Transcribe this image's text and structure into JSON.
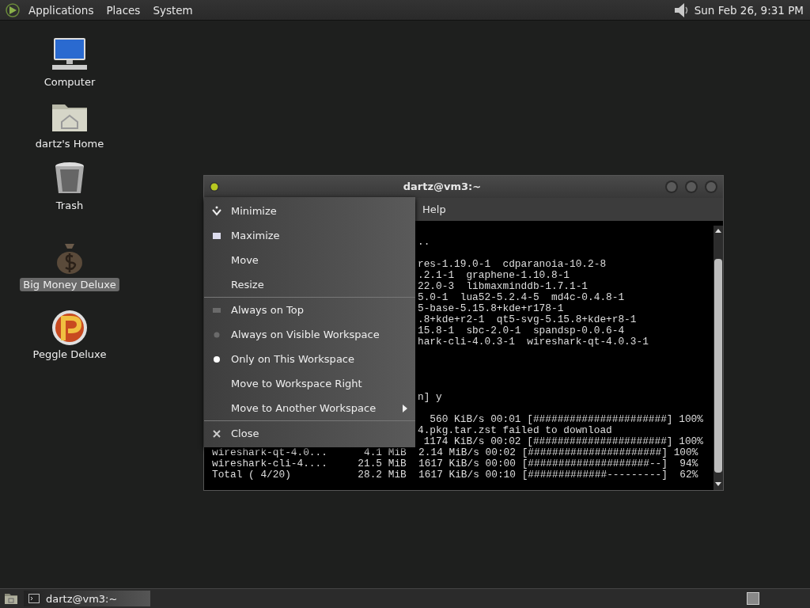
{
  "top_panel": {
    "menus": [
      "Applications",
      "Places",
      "System"
    ],
    "clock": "Sun Feb 26, 9:31 PM"
  },
  "desktop_icons": [
    {
      "kind": "computer",
      "label": "Computer",
      "selected": false
    },
    {
      "kind": "home",
      "label": "dartz's Home",
      "selected": false
    },
    {
      "kind": "trash",
      "label": "Trash",
      "selected": false
    },
    {
      "kind": "money",
      "label": "Big Money Deluxe",
      "selected": true
    },
    {
      "kind": "peggle",
      "label": "Peggle Deluxe",
      "selected": false
    }
  ],
  "window": {
    "title": "dartz@vm3:~",
    "menu_bar": [
      "Help"
    ],
    "terminal_lines": [
      {
        "kind": "blank"
      },
      {
        "kind": "clipped",
        "text": ".."
      },
      {
        "kind": "blank"
      },
      {
        "kind": "clipped",
        "text": "res-1.19.0-1  cdparanoia-10.2-8"
      },
      {
        "kind": "clipped",
        "text": ".2.1-1  graphene-1.10.8-1"
      },
      {
        "kind": "clipped",
        "text": "22.0-3  libmaxminddb-1.7.1-1"
      },
      {
        "kind": "clipped",
        "text": "5.0-1  lua52-5.2.4-5  md4c-0.4.8-1"
      },
      {
        "kind": "clipped",
        "text": "5-base-5.15.8+kde+r178-1"
      },
      {
        "kind": "clipped",
        "text": ".8+kde+r2-1  qt5-svg-5.15.8+kde+r8-1"
      },
      {
        "kind": "clipped",
        "text": "15.8-1  sbc-2.0-1  spandsp-0.0.6-4"
      },
      {
        "kind": "clipped",
        "text": "hark-cli-4.0.3-1  wireshark-qt-4.0.3-1"
      },
      {
        "kind": "blank"
      },
      {
        "kind": "blank"
      },
      {
        "kind": "blank"
      },
      {
        "kind": "blank"
      },
      {
        "kind": "clipped",
        "text": "n] y"
      },
      {
        "kind": "blank"
      },
      {
        "kind": "clipped",
        "text": "  560 KiB/s 00:01 [######################] 100%"
      },
      {
        "kind": "clipped",
        "text": "4.pkg.tar.zst failed to download"
      },
      {
        "kind": "clipped",
        "text": " 1174 KiB/s 00:02 [######################] 100%"
      },
      {
        "kind": "full",
        "text": "wireshark-qt-4.0...      4.1 MiB  2.14 MiB/s 00:02 [######################] 100%"
      },
      {
        "kind": "full",
        "text": "wireshark-cli-4....     21.5 MiB  1617 KiB/s 00:00 [####################--]  94%"
      },
      {
        "kind": "full",
        "text": "Total ( 4/20)           28.2 MiB  1617 KiB/s 00:10 [#############---------]  62%"
      }
    ]
  },
  "window_menu": {
    "items": [
      {
        "kind": "minimize",
        "label": "Minimize"
      },
      {
        "kind": "maximize",
        "label": "Maximize"
      },
      {
        "kind": "plain",
        "label": "Move"
      },
      {
        "kind": "plain",
        "label": "Resize"
      },
      {
        "kind": "separator"
      },
      {
        "kind": "check",
        "label": "Always on Top",
        "checked": false
      },
      {
        "kind": "radio",
        "label": "Always on Visible Workspace",
        "selected": false
      },
      {
        "kind": "radio",
        "label": "Only on This Workspace",
        "selected": true
      },
      {
        "kind": "plain",
        "label": "Move to Workspace Right"
      },
      {
        "kind": "submenu",
        "label": "Move to Another Workspace"
      },
      {
        "kind": "separator"
      },
      {
        "kind": "close",
        "label": "Close"
      }
    ]
  },
  "taskbar": {
    "tasks": [
      {
        "label": "dartz@vm3:~",
        "selected": true
      }
    ]
  }
}
